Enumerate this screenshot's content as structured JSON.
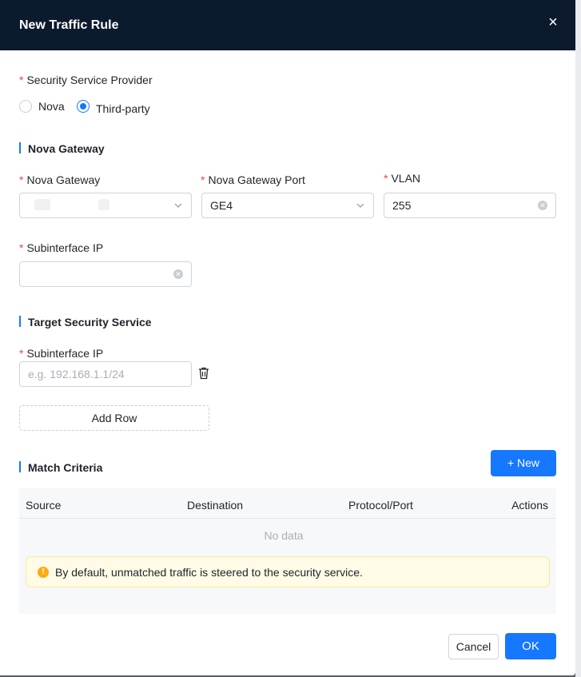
{
  "modal": {
    "title": "New Traffic Rule",
    "close_icon": "×"
  },
  "provider": {
    "label": "Security Service Provider",
    "options": [
      {
        "label": "Nova",
        "selected": false
      },
      {
        "label": "Third-party",
        "selected": true
      }
    ]
  },
  "nova_gateway_section": {
    "title": "Nova Gateway",
    "gateway_label": "Nova Gateway",
    "gateway_value": "",
    "port_label": "Nova Gateway Port",
    "port_value": "GE4",
    "vlan_label": "VLAN",
    "vlan_value": "255",
    "subif_label": "Subinterface IP",
    "subif_value": ""
  },
  "target_section": {
    "title": "Target Security Service",
    "subif_label": "Subinterface IP",
    "subif_placeholder": "e.g. 192.168.1.1/24",
    "add_row_label": "Add Row"
  },
  "match_section": {
    "title": "Match Criteria",
    "new_button": "+ New",
    "columns": [
      "Source",
      "Destination",
      "Protocol/Port",
      "Actions"
    ],
    "empty_text": "No data",
    "alert_text": "By default, unmatched traffic is steered to the security service."
  },
  "footer": {
    "cancel_label": "Cancel",
    "ok_label": "OK"
  },
  "colors": {
    "primary": "#1677ff",
    "header_bg": "#0c1a2e",
    "required": "#f53f3f",
    "alert_bg": "#fffbe6"
  }
}
